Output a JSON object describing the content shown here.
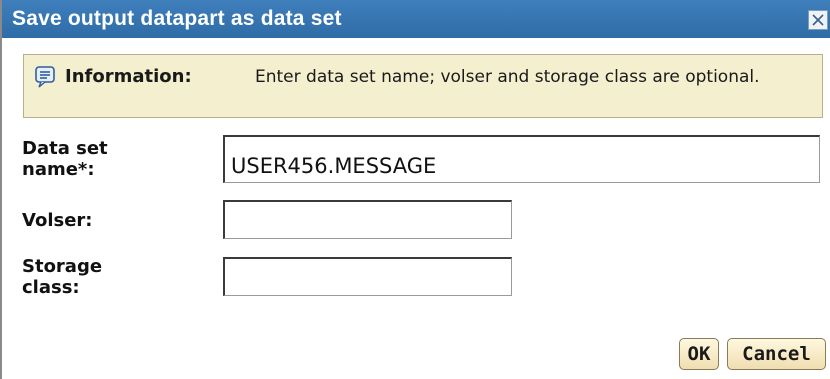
{
  "dialog": {
    "title": "Save output datapart as data set"
  },
  "info": {
    "label": "Information:",
    "text": "Enter data set name; volser and storage class are optional."
  },
  "fields": {
    "dsname": {
      "label": "Data set name*:",
      "value": "USER456.MESSAGE"
    },
    "volser": {
      "label": "Volser:",
      "value": ""
    },
    "storage_class": {
      "label": "Storage class:",
      "value": ""
    }
  },
  "buttons": {
    "ok": "OK",
    "cancel": "Cancel"
  },
  "colors": {
    "titlebar": "#2f6ca8",
    "info_background": "#f4efcf",
    "button_background": "#f0deb0"
  }
}
